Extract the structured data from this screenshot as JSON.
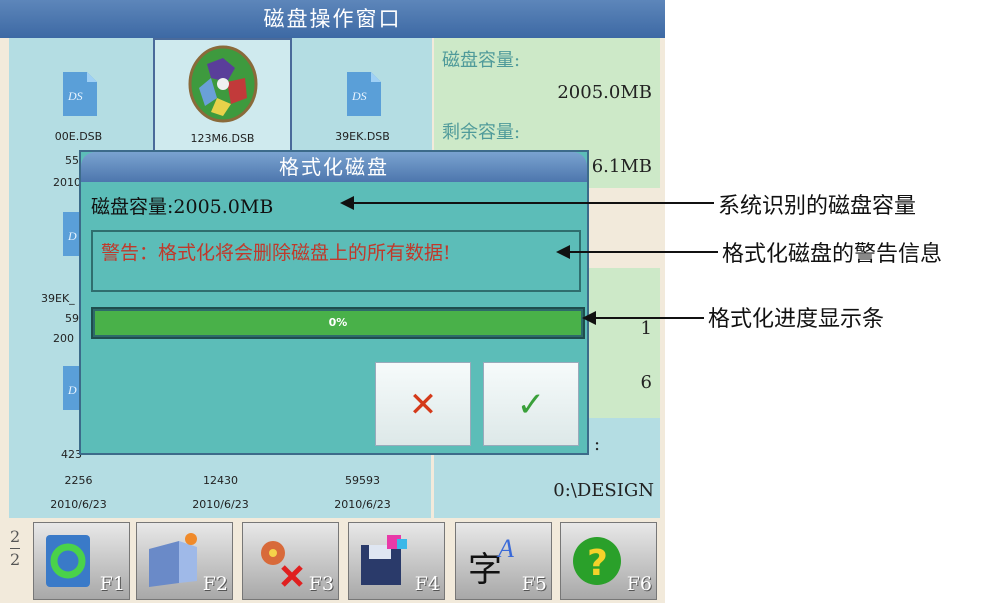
{
  "window": {
    "title": "磁盘操作窗口"
  },
  "files": [
    {
      "name": "00E.DSB",
      "extra1": "55",
      "extra2": "2010"
    },
    {
      "name": "123M6.DSB"
    },
    {
      "name": "39EK.DSB"
    }
  ],
  "left_col": {
    "row2": [
      "39EK_",
      "59",
      "200"
    ],
    "row3": [
      "423"
    ]
  },
  "bottom_row": [
    {
      "size": "2256",
      "date": "2010/6/23"
    },
    {
      "size": "12430",
      "date": "2010/6/23"
    },
    {
      "size": "59593",
      "date": "2010/6/23"
    }
  ],
  "info": {
    "capacity_label": "磁盘容量:",
    "capacity_value": "2005.0MB",
    "remaining_label": "剩余容量:",
    "remaining_value_partial": "6.1MB",
    "row_a": "1",
    "row_b": "6",
    "colon": ":",
    "path": "0:\\DESIGN"
  },
  "dialog": {
    "title": "格式化磁盘",
    "capacity_text": "磁盘容量:2005.0MB",
    "warning": "警告：格式化将会删除磁盘上的所有数据!",
    "progress_percent": 0,
    "progress_text": "0%",
    "cancel_symbol": "✕",
    "confirm_symbol": "✓"
  },
  "function_keys": [
    {
      "label": "F1",
      "icon": "refresh-icon"
    },
    {
      "label": "F2",
      "icon": "new-folder-icon"
    },
    {
      "label": "F3",
      "icon": "delete-icon"
    },
    {
      "label": "F4",
      "icon": "save-disk-icon"
    },
    {
      "label": "F5",
      "icon": "font-icon"
    },
    {
      "label": "F6",
      "icon": "help-icon"
    }
  ],
  "page_indicator": {
    "top": "2",
    "bottom": "2"
  },
  "annotations": {
    "capacity": "系统识别的磁盘容量",
    "warning": "格式化磁盘的警告信息",
    "progress": "格式化进度显示条"
  },
  "colors": {
    "title_bar": "#3d69a4",
    "grid_bg": "#b4dde3",
    "info_bg": "#cde9c8",
    "dialog_bg": "#5cbdb8",
    "progress": "#49b149",
    "warning_text": "#c0392b"
  }
}
